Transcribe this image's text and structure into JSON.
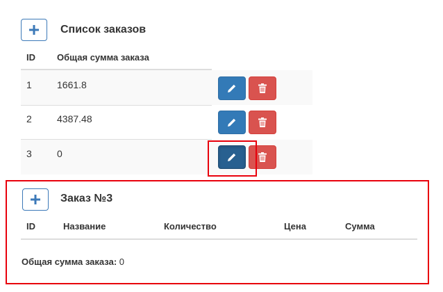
{
  "orders_list": {
    "title": "Список заказов",
    "add_button_icon": "plus-icon",
    "columns": {
      "id": "ID",
      "total": "Общая сумма заказа"
    },
    "rows": [
      {
        "id": "1",
        "total": "1661.8"
      },
      {
        "id": "2",
        "total": "4387.48"
      },
      {
        "id": "3",
        "total": "0"
      }
    ],
    "edit_icon": "pencil-icon",
    "delete_icon": "trash-icon"
  },
  "order_detail": {
    "title": "Заказ №3",
    "add_button_icon": "plus-icon",
    "columns": {
      "id": "ID",
      "name": "Название",
      "quantity": "Количество",
      "price": "Цена",
      "sum": "Сумма"
    },
    "total_label": "Общая сумма заказа:",
    "total_value": "0"
  },
  "colors": {
    "primary": "#337ab7",
    "primary_active": "#286090",
    "danger": "#d9534f",
    "highlight": "#e8000b",
    "stripe": "#f9f9f9"
  }
}
